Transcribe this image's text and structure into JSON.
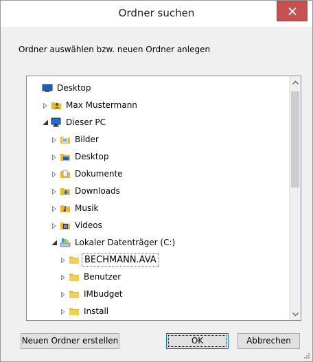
{
  "window": {
    "title": "Ordner suchen",
    "description": "Ordner auswählen bzw. neuen Ordner anlegen"
  },
  "tree": {
    "items": [
      {
        "label": "Desktop",
        "icon": "desktop-icon",
        "level": 0,
        "expander": "none"
      },
      {
        "label": "Max Mustermann",
        "icon": "user-folder-icon",
        "level": 1,
        "expander": "collapsed"
      },
      {
        "label": "Dieser PC",
        "icon": "computer-icon",
        "level": 1,
        "expander": "expanded"
      },
      {
        "label": "Bilder",
        "icon": "pictures-folder-icon",
        "level": 2,
        "expander": "collapsed"
      },
      {
        "label": "Desktop",
        "icon": "desktop-folder-icon",
        "level": 2,
        "expander": "collapsed"
      },
      {
        "label": "Dokumente",
        "icon": "documents-folder-icon",
        "level": 2,
        "expander": "collapsed"
      },
      {
        "label": "Downloads",
        "icon": "downloads-folder-icon",
        "level": 2,
        "expander": "collapsed"
      },
      {
        "label": "Musik",
        "icon": "music-folder-icon",
        "level": 2,
        "expander": "collapsed"
      },
      {
        "label": "Videos",
        "icon": "videos-folder-icon",
        "level": 2,
        "expander": "collapsed"
      },
      {
        "label": "Lokaler Datenträger (C:)",
        "icon": "drive-icon",
        "level": 2,
        "expander": "expanded"
      },
      {
        "label": "BECHMANN.AVA",
        "icon": "folder-icon",
        "level": 3,
        "expander": "collapsed",
        "selected": true
      },
      {
        "label": "Benutzer",
        "icon": "folder-icon",
        "level": 3,
        "expander": "collapsed"
      },
      {
        "label": "IMbudget",
        "icon": "folder-icon",
        "level": 3,
        "expander": "collapsed"
      },
      {
        "label": "Install",
        "icon": "folder-icon",
        "level": 3,
        "expander": "collapsed"
      }
    ]
  },
  "buttons": {
    "new_folder": "Neuen Ordner erstellen",
    "ok": "OK",
    "cancel": "Abbrechen"
  },
  "colors": {
    "close_bg": "#c75050",
    "folder": "#e8b931",
    "border": "#828790",
    "default_btn_border": "#0078d7"
  }
}
